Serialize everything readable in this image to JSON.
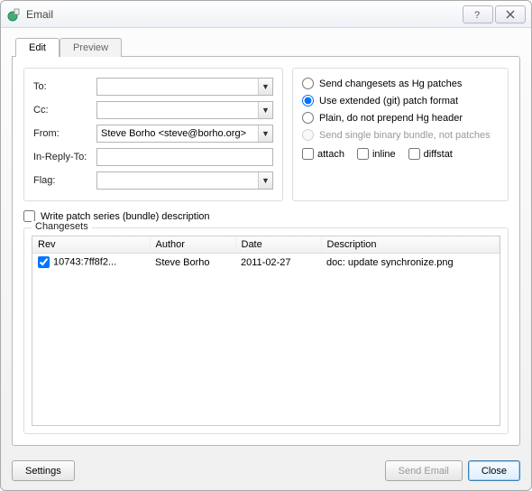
{
  "window": {
    "title": "Email"
  },
  "tabs": {
    "edit": "Edit",
    "preview": "Preview"
  },
  "fields": {
    "to_label": "To:",
    "to_value": "",
    "cc_label": "Cc:",
    "cc_value": "",
    "from_label": "From:",
    "from_value": "Steve Borho <steve@borho.org>",
    "inreplyto_label": "In-Reply-To:",
    "inreplyto_value": "",
    "flag_label": "Flag:",
    "flag_value": ""
  },
  "options": {
    "radio_hg": "Send changesets as Hg patches",
    "radio_git": "Use extended (git) patch format",
    "radio_plain": "Plain, do not prepend Hg header",
    "radio_bundle": "Send single binary bundle, not patches",
    "selected": "git",
    "attach": "attach",
    "inline": "inline",
    "diffstat": "diffstat"
  },
  "writedesc": {
    "label": "Write patch series (bundle) description"
  },
  "changesets": {
    "legend": "Changesets",
    "columns": {
      "rev": "Rev",
      "author": "Author",
      "date": "Date",
      "description": "Description"
    },
    "rows": [
      {
        "checked": true,
        "rev": "10743:7ff8f2...",
        "author": "Steve Borho",
        "date": "2011-02-27",
        "description": "doc: update synchronize.png"
      }
    ]
  },
  "footer": {
    "settings": "Settings",
    "send": "Send Email",
    "close": "Close"
  }
}
